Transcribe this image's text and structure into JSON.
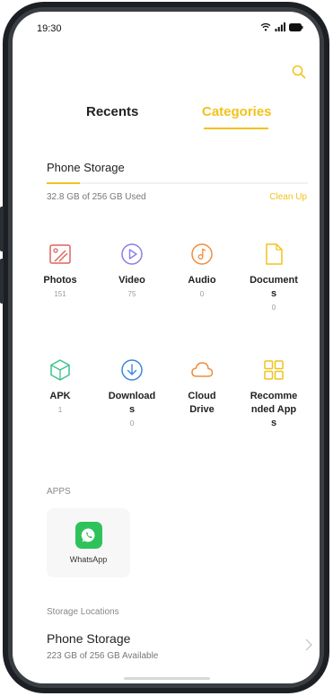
{
  "status": {
    "time": "19:30"
  },
  "tabs": {
    "recents": "Recents",
    "categories": "Categories"
  },
  "storage": {
    "title": "Phone Storage",
    "used_text": "32.8 GB of 256 GB Used",
    "used_fraction": 0.128,
    "cleanup": "Clean Up"
  },
  "categories": [
    {
      "label": "Photos",
      "count": "151",
      "icon": "image-icon",
      "color": "#e0625f"
    },
    {
      "label": "Video",
      "count": "75",
      "icon": "play-icon",
      "color": "#8a7ee6"
    },
    {
      "label": "Audio",
      "count": "0",
      "icon": "music-icon",
      "color": "#f08d3b"
    },
    {
      "label": "Documents",
      "count": "0",
      "icon": "document-icon",
      "color": "#f3c21b"
    },
    {
      "label": "APK",
      "count": "1",
      "icon": "package-icon",
      "color": "#3cc28a"
    },
    {
      "label": "Downloads",
      "count": "0",
      "icon": "download-icon",
      "color": "#3b86e0"
    },
    {
      "label": "Cloud Drive",
      "count": "",
      "icon": "cloud-icon",
      "color": "#f08d3b"
    },
    {
      "label": "Recommended Apps",
      "count": "",
      "icon": "grid-icon",
      "color": "#f3c21b"
    }
  ],
  "apps": {
    "header": "APPS",
    "items": [
      {
        "label": "WhatsApp",
        "icon": "whatsapp-icon",
        "color": "#2fc25b"
      }
    ]
  },
  "locations": {
    "header": "Storage Locations",
    "items": [
      {
        "title": "Phone Storage",
        "subtitle": "223 GB of 256 GB Available"
      }
    ]
  }
}
